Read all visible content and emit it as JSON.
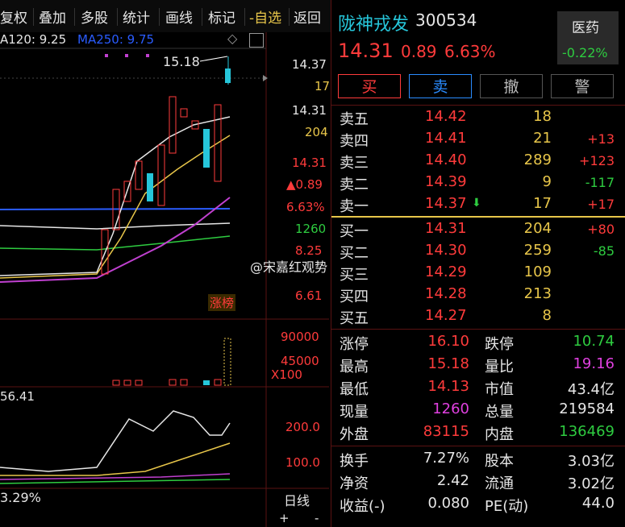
{
  "toolbar": {
    "items": [
      "复权",
      "叠加",
      "多股",
      "统计",
      "画线",
      "标记",
      "-自选",
      "返回"
    ]
  },
  "main_chart": {
    "ma_labels": {
      "ma120": "A120: 9.25",
      "ma250": "MA250: 9.75"
    },
    "high_mark": "15.18",
    "axis_labels": {
      "price_top": "14.37",
      "vol_top": "17",
      "price2": "14.31",
      "vol2": "204",
      "price3": "14.31",
      "change": "▲0.89",
      "pct": "6.63%",
      "vol3": "1260",
      "tick1": "8.25",
      "tick2": "6.61"
    },
    "badge": "涨榜",
    "watermark": "@宋嘉红观势",
    "volume_axis": {
      "t1": "90000",
      "t2": "45000",
      "unit": "X100"
    },
    "indicator": {
      "label": "56.41",
      "t1": "200.0",
      "t2": "100.0"
    },
    "bottom": {
      "pct": "3.29%",
      "period": "日线",
      "plus": "+",
      "minus": "-"
    }
  },
  "stock": {
    "name": "陇神戎发",
    "code": "300534",
    "price": "14.31",
    "change": "0.89",
    "pct": "6.63%",
    "sector": "医药",
    "sector_pct": "-0.22%"
  },
  "buttons": {
    "buy": "买",
    "sell": "卖",
    "cancel": "撤",
    "alert": "警"
  },
  "sell_orders": [
    {
      "label": "卖五",
      "price": "14.42",
      "vol": "18",
      "delta": ""
    },
    {
      "label": "卖四",
      "price": "14.41",
      "vol": "21",
      "delta": "+13"
    },
    {
      "label": "卖三",
      "price": "14.40",
      "vol": "289",
      "delta": "+123"
    },
    {
      "label": "卖二",
      "price": "14.39",
      "vol": "9",
      "delta": "-117"
    },
    {
      "label": "卖一",
      "price": "14.37",
      "vol": "17",
      "delta": "+17"
    }
  ],
  "buy_orders": [
    {
      "label": "买一",
      "price": "14.31",
      "vol": "204",
      "delta": "+80"
    },
    {
      "label": "买二",
      "price": "14.30",
      "vol": "259",
      "delta": "-85"
    },
    {
      "label": "买三",
      "price": "14.29",
      "vol": "109",
      "delta": ""
    },
    {
      "label": "买四",
      "price": "14.28",
      "vol": "213",
      "delta": ""
    },
    {
      "label": "买五",
      "price": "14.27",
      "vol": "8",
      "delta": ""
    }
  ],
  "stats": [
    {
      "l1": "涨停",
      "v1": "16.10",
      "l2": "跌停",
      "v2": "10.74"
    },
    {
      "l1": "最高",
      "v1": "15.18",
      "l2": "量比",
      "v2": "19.16"
    },
    {
      "l1": "最低",
      "v1": "14.13",
      "l2": "市值",
      "v2": "43.4亿"
    },
    {
      "l1": "现量",
      "v1": "1260",
      "l2": "总量",
      "v2": "219584"
    },
    {
      "l1": "外盘",
      "v1": "83115",
      "l2": "内盘",
      "v2": "136469"
    }
  ],
  "stats2": [
    {
      "l1": "换手",
      "v1": "7.27%",
      "l2": "股本",
      "v2": "3.03亿"
    },
    {
      "l1": "净资",
      "v1": "2.42",
      "l2": "流通",
      "v2": "3.02亿"
    },
    {
      "l1": "收益(-)",
      "v1": "0.080",
      "l2": "PE(动)",
      "v2": "44.0"
    }
  ],
  "colors": {
    "up": "#ff3b3b",
    "down": "#2ecc40",
    "flat": "#e8c64a",
    "cyan": "#26c6da"
  }
}
